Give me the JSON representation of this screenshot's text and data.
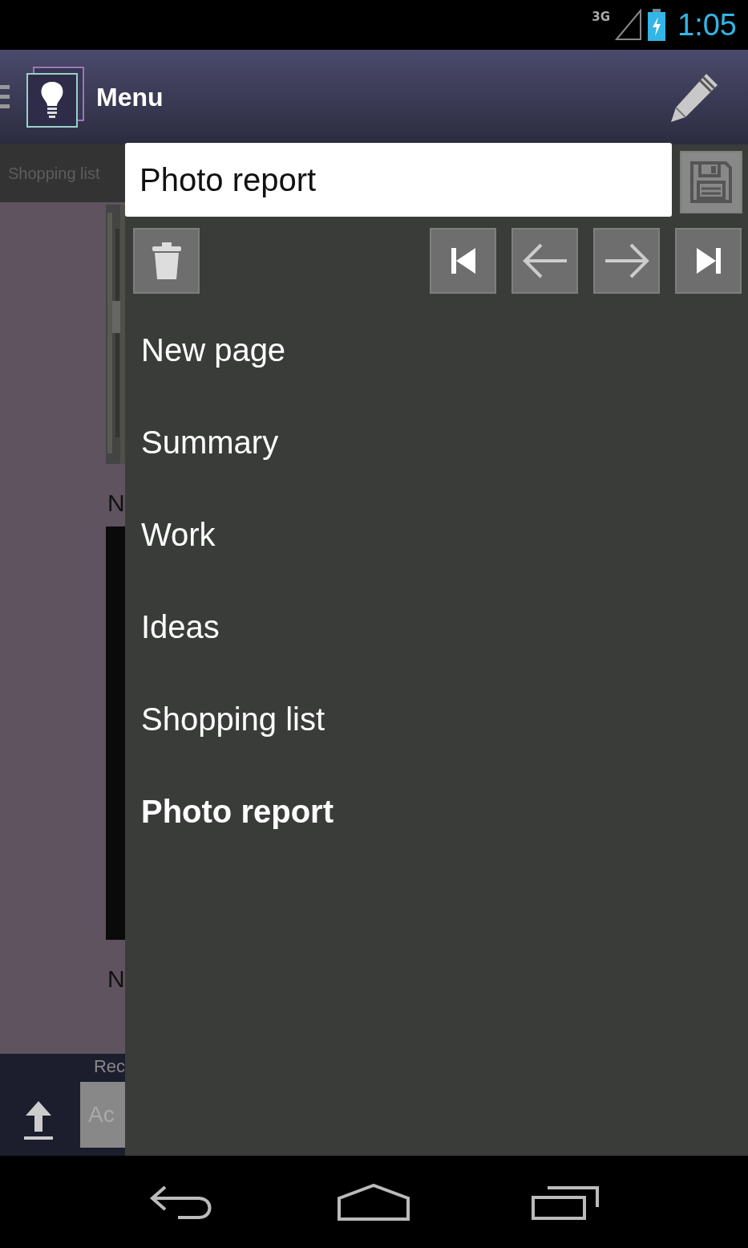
{
  "status_bar": {
    "network": "3G",
    "time": "1:05"
  },
  "app_bar": {
    "title": "Menu"
  },
  "background": {
    "tab": "Shopping list",
    "captions": [
      "N",
      "N"
    ],
    "bottom_label": "Rec",
    "input_placeholder": "Ac"
  },
  "drawer": {
    "page_title": "Photo report",
    "items": [
      {
        "label": "New page",
        "selected": false
      },
      {
        "label": "Summary",
        "selected": false
      },
      {
        "label": "Work",
        "selected": false
      },
      {
        "label": "Ideas",
        "selected": false
      },
      {
        "label": "Shopping list",
        "selected": false
      },
      {
        "label": "Photo report",
        "selected": true
      }
    ]
  }
}
